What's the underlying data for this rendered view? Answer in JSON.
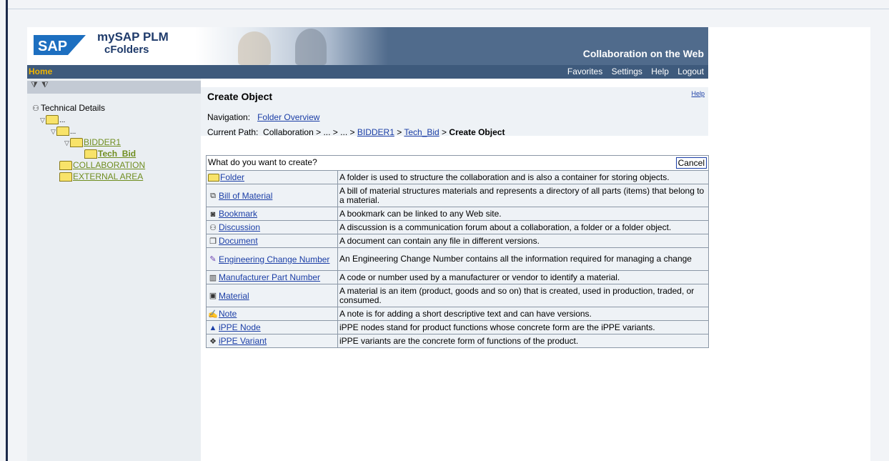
{
  "header": {
    "product": "mySAP PLM",
    "module": "cFolders",
    "tagline": "Collaboration on the Web"
  },
  "navbar": {
    "home": "Home",
    "links": [
      "Favorites",
      "Settings",
      "Help",
      "Logout"
    ]
  },
  "tree": {
    "root": "Technical Details",
    "items": [
      {
        "label": "...",
        "level": 1
      },
      {
        "label": "...",
        "level": 2
      },
      {
        "label": "BIDDER1",
        "level": 3
      },
      {
        "label": "Tech_Bid",
        "level": 4,
        "selected": true
      },
      {
        "label": "COLLABORATION",
        "level": 1
      },
      {
        "label": "EXTERNAL AREA",
        "level": 1
      }
    ]
  },
  "main": {
    "title": "Create Object",
    "help": "Help",
    "navigation_label": "Navigation:",
    "navigation_link": "Folder Overview",
    "path_label": "Current Path:",
    "path_parts": [
      "Collaboration",
      "...",
      "...",
      "BIDDER1",
      "Tech_Bid",
      "Create Object"
    ],
    "question": "What do you want to create?",
    "cancel": "Cancel",
    "objects": [
      {
        "name": "Folder",
        "icon": "folder-icon",
        "desc": "A folder is used to structure the collaboration and is also a container for storing objects."
      },
      {
        "name": "Bill of Material",
        "icon": "bom-icon",
        "desc": "A bill of material structures materials and represents a directory of all parts (items) that belong to a material."
      },
      {
        "name": "Bookmark",
        "icon": "bookmark-icon",
        "desc": "A bookmark can be linked to any Web site."
      },
      {
        "name": "Discussion",
        "icon": "discussion-icon",
        "desc": "A discussion is a communication forum about a collaboration, a folder or a folder object."
      },
      {
        "name": "Document",
        "icon": "document-icon",
        "desc": "A document can contain any file in different versions."
      },
      {
        "name": "Engineering Change Number",
        "icon": "change-number-icon",
        "desc": "An Engineering Change Number contains all the information required for managing a change"
      },
      {
        "name": "Manufacturer Part Number",
        "icon": "part-number-icon",
        "desc": "A code or number used by a manufacturer or vendor to identify a material."
      },
      {
        "name": "Material",
        "icon": "material-icon",
        "desc": "A material is an item (product, goods and so on) that is created, used in production, traded, or consumed."
      },
      {
        "name": "Note",
        "icon": "note-icon",
        "desc": "A note is for adding a short descriptive text and can have versions."
      },
      {
        "name": "iPPE Node",
        "icon": "ippe-node-icon",
        "desc": "iPPE nodes stand for product functions whose concrete form are the iPPE variants."
      },
      {
        "name": "iPPE Variant",
        "icon": "ippe-variant-icon",
        "desc": "iPPE variants are the concrete form of functions of the product."
      }
    ]
  },
  "colors": {
    "header_bg": "#506b8c",
    "nav_bg": "#3e5a7c",
    "home_accent": "#f0b400",
    "link_blue": "#1b3ea6",
    "tree_link": "#6f8d1f"
  }
}
